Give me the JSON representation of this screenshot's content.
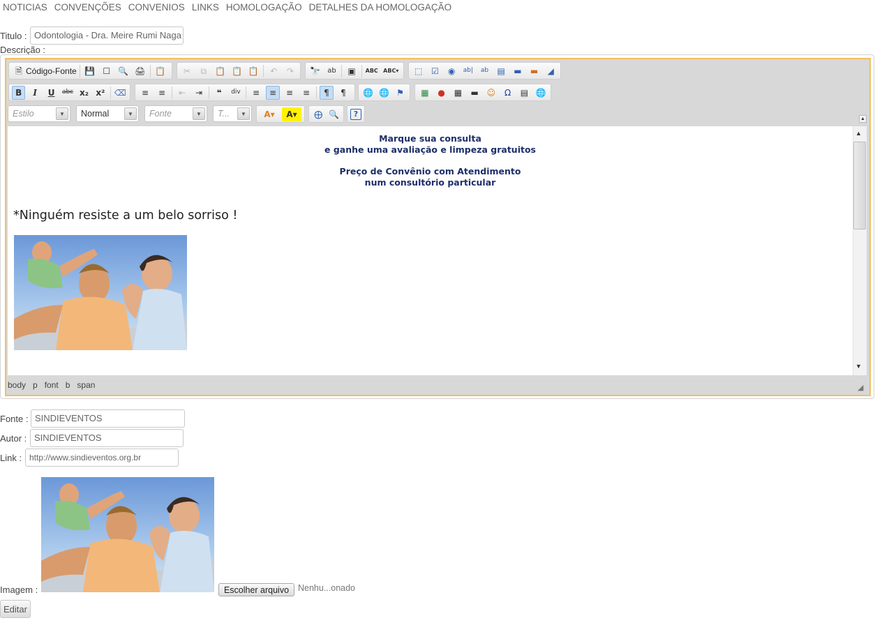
{
  "nav": [
    "NOTICIAS",
    "CONVENÇÕES",
    "CONVENIOS",
    "LINKS",
    "HOMOLOGAÇÃO",
    "DETALHES DA HOMOLOGAÇÃO"
  ],
  "form": {
    "titulo_label": "Titulo :",
    "titulo_value": "Odontologia - Dra. Meire Rumi Naga",
    "descricao_label": "Descrição :",
    "fonte_label": "Fonte :",
    "fonte_value": "SINDIEVENTOS",
    "autor_label": "Autor :",
    "autor_value": "SINDIEVENTOS",
    "link_label": "Link :",
    "link_value": "http://www.sindieventos.org.br",
    "imagem_label": "Imagem :",
    "file_button": "Escolher arquivo",
    "file_status": "Nenhu...onado",
    "submit_label": "Editar"
  },
  "editor": {
    "source_button": "Código-Fonte",
    "combos": {
      "estilo": "Estilo",
      "format": "Normal",
      "fonte": "Fonte",
      "tamanho": "T..."
    },
    "content": {
      "line1": "Marque sua consulta",
      "line2": "e ganhe uma avaliação e limpeza gratuitos",
      "line3": "Preço de Convênio com Atendimento",
      "line4": "num consultório particular",
      "slogan": "*Ninguém resiste a um belo sorriso !"
    },
    "path": [
      "body",
      "p",
      "font",
      "b",
      "span"
    ]
  },
  "colors": {
    "editor_border": "#f0c060",
    "content_heading": "#1d2f6a"
  }
}
